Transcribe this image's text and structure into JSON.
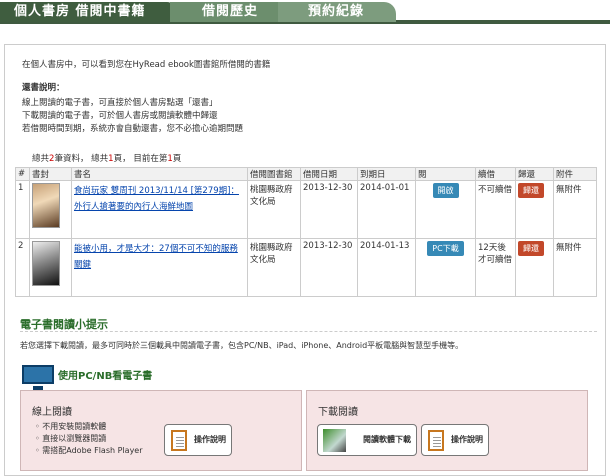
{
  "tabs": {
    "current": "個人書房 借閱中書籍",
    "history": "借閱歷史",
    "reserve": "預約紀錄"
  },
  "intro": "在個人書房中，可以看到您在HyRead ebook圖書館所借閱的書籍",
  "instructions": {
    "title": "還書說明：",
    "lines": [
      "線上閱讀的電子書，可直接於個人書房點選「還書」",
      "下載閱讀的電子書，可於個人書房或閱讀軟體中歸還",
      "若借閱時間到期，系統亦會自動還書，您不必擔心逾期問題"
    ]
  },
  "summary": {
    "total_prefix": "總共",
    "total": "2",
    "total_unit": "筆資料，",
    "pages_prefix": "總共",
    "pages": "1",
    "pages_unit": "頁，",
    "current_prefix": "目前在第",
    "current": "1",
    "current_unit": "頁"
  },
  "table": {
    "headers": [
      "#",
      "書封",
      "書名",
      "借閱圖書館",
      "借閱日期",
      "到期日",
      "閱",
      "續借",
      "歸還",
      "附件"
    ],
    "rows": [
      {
        "num": "1",
        "title": "食尚玩家 雙周刊 2013/11/14 [第279期]：外行人搶著要的內行人海鮮地圖",
        "library": "桃園縣政府文化局",
        "borrow": "2013-12-30",
        "due": "2014-01-01",
        "action": "開啟",
        "renew": "不可續借",
        "return": "歸還",
        "attachment": "無附件"
      },
      {
        "num": "2",
        "title": "能被小用，才是大才：27個不可不知的服務關鍵",
        "library": "桃園縣政府文化局",
        "borrow": "2013-12-30",
        "due": "2014-01-13",
        "action": "PC下載",
        "renew": "12天後才可續借",
        "return": "歸還",
        "attachment": "無附件"
      }
    ]
  },
  "tips": {
    "heading": "電子書閱讀小提示",
    "body": "若您選擇下載閱讀，最多可同時於三個載具中閱讀電子書，包含PC/NB、iPad、iPhone、Android平板電腦與智慧型手機等。",
    "pcnb": "使用PC/NB看電子書"
  },
  "online": {
    "title": "線上閱讀",
    "items": [
      "不用安裝閱讀軟體",
      "直接以瀏覽器閱讀",
      "需搭配Adobe Flash Player"
    ],
    "guide": "操作說明"
  },
  "download": {
    "title": "下載閱讀",
    "software": "閱讀軟體下載",
    "guide": "操作說明"
  },
  "colors": {
    "tab_dark": "#3f5d3f",
    "tab_light": "#7d9c7e",
    "button_blue": "#3689b6",
    "button_red": "#c2482a",
    "box_pink": "#f6e4e5"
  }
}
